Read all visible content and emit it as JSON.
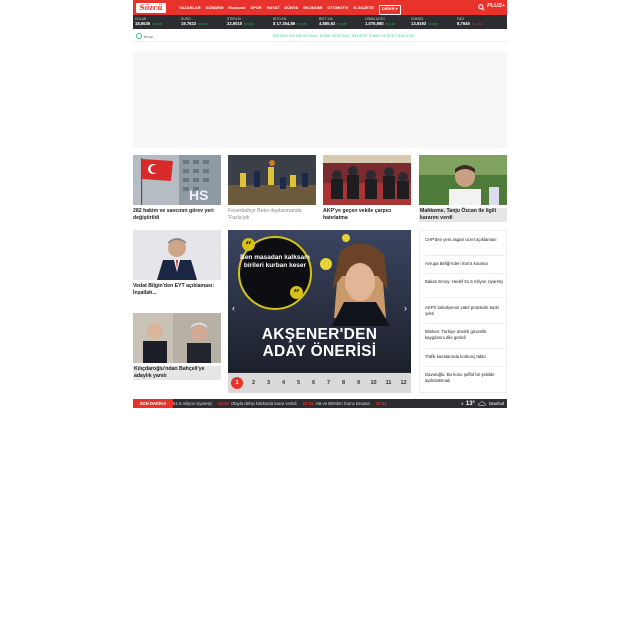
{
  "header": {
    "logo": "Sözcü",
    "nav": [
      "YAZARLAR",
      "GÜNDEM",
      "Ekonomi",
      "SPOR",
      "HAYAT",
      "DÜNYA",
      "EKONOMİ",
      "OTOMOTİV",
      "E-GAZETE",
      "DİĞER"
    ],
    "plus": "PLUS+"
  },
  "ticker": [
    {
      "name": "DOLAR",
      "value": "18,6535",
      "change": "% 0,08",
      "dir": "up"
    },
    {
      "name": "EURO",
      "value": "19,7623",
      "change": "% 0,35",
      "dir": "up"
    },
    {
      "name": "STERLİN",
      "value": "22,9010",
      "change": "% 0,16",
      "dir": "up"
    },
    {
      "name": "BITCOIN",
      "value": "$ 17.254,86",
      "change": "% 0,06",
      "dir": "up"
    },
    {
      "name": "BIST 100",
      "value": "4.855,92",
      "change": "% 0,05",
      "dir": "up"
    },
    {
      "name": "GRAM ALTIN",
      "value": "1.075,980",
      "change": "% 0,16",
      "dir": "up"
    },
    {
      "name": "GÜMÜŞ",
      "value": "13,9193",
      "change": "% 0,03",
      "dir": "up"
    },
    {
      "name": "FAİZ",
      "value": "8,7645",
      "change": "% -1,82",
      "dir": "dn"
    }
  ],
  "subbar": {
    "brand": "beup",
    "promo": "ŞEHRİN EN HEYECANLI KÖŞE NOKTASI, HEDEFE ŞİMDİ KEŞFET KATILIN!"
  },
  "cards": [
    {
      "caption": "282 hakim ve savcının görev yeri değiştirildi",
      "style": "bold"
    },
    {
      "caption": "Fenerbahçe Beko deplasmanda 'Fazla'ydı",
      "style": "grey"
    },
    {
      "caption": "AKP'ye geçen vekile çarpıcı hatırlatma",
      "style": "bold"
    },
    {
      "caption": "Mahkeme, Tanju Özcan ile ilgili kararını verdi",
      "style": "hl"
    },
    {
      "caption": "Vedat Bilgin'den EYT açıklaması: İnşallah...",
      "style": "bold"
    },
    {
      "caption": "Kılıçdaroğlu'ndan Bahçeli'ye adaylık yanıtı",
      "style": "hl"
    }
  ],
  "slider": {
    "quote": "Ben masadan kalksam birileri kurban keser",
    "headline_line1": "AKŞENER'DEN",
    "headline_line2": "ADAY ÖNERİSİ",
    "pages": [
      "1",
      "2",
      "3",
      "4",
      "5",
      "6",
      "7",
      "8",
      "9",
      "10",
      "11",
      "12"
    ],
    "active_page": "1"
  },
  "sidelist": [
    "CHP'den yeni asgari ücret açıklaması",
    "Avrupa Birliği'nden İran'a kınama",
    "Bakan Ersoy: Hedef 51,5 milyon ziyaretçi",
    "AKP'li belediyenin vakıf protokolü tepki çekti",
    "Blinken: Türkiye önemli güvenlik kaygılarını dile getirdi",
    "Trafik kazalarında korkunç tablo",
    "Davutoğlu: Bu konu şeffaf bir şekilde aydınlatılmalı"
  ],
  "breaking": {
    "label": "SON DAKİKA",
    "items": [
      {
        "time": "",
        "text": "51,5 milyon ziyaretçi"
      },
      {
        "time": "23:43",
        "text": "Olayla dehşi hakkında karar verildi"
      },
      {
        "time": "23:12",
        "text": "AB ve BM'den İran'a kınama"
      },
      {
        "time": "22:41",
        "text": ""
      }
    ],
    "weather_temp": "13°",
    "weather_city": "İstanbul"
  }
}
